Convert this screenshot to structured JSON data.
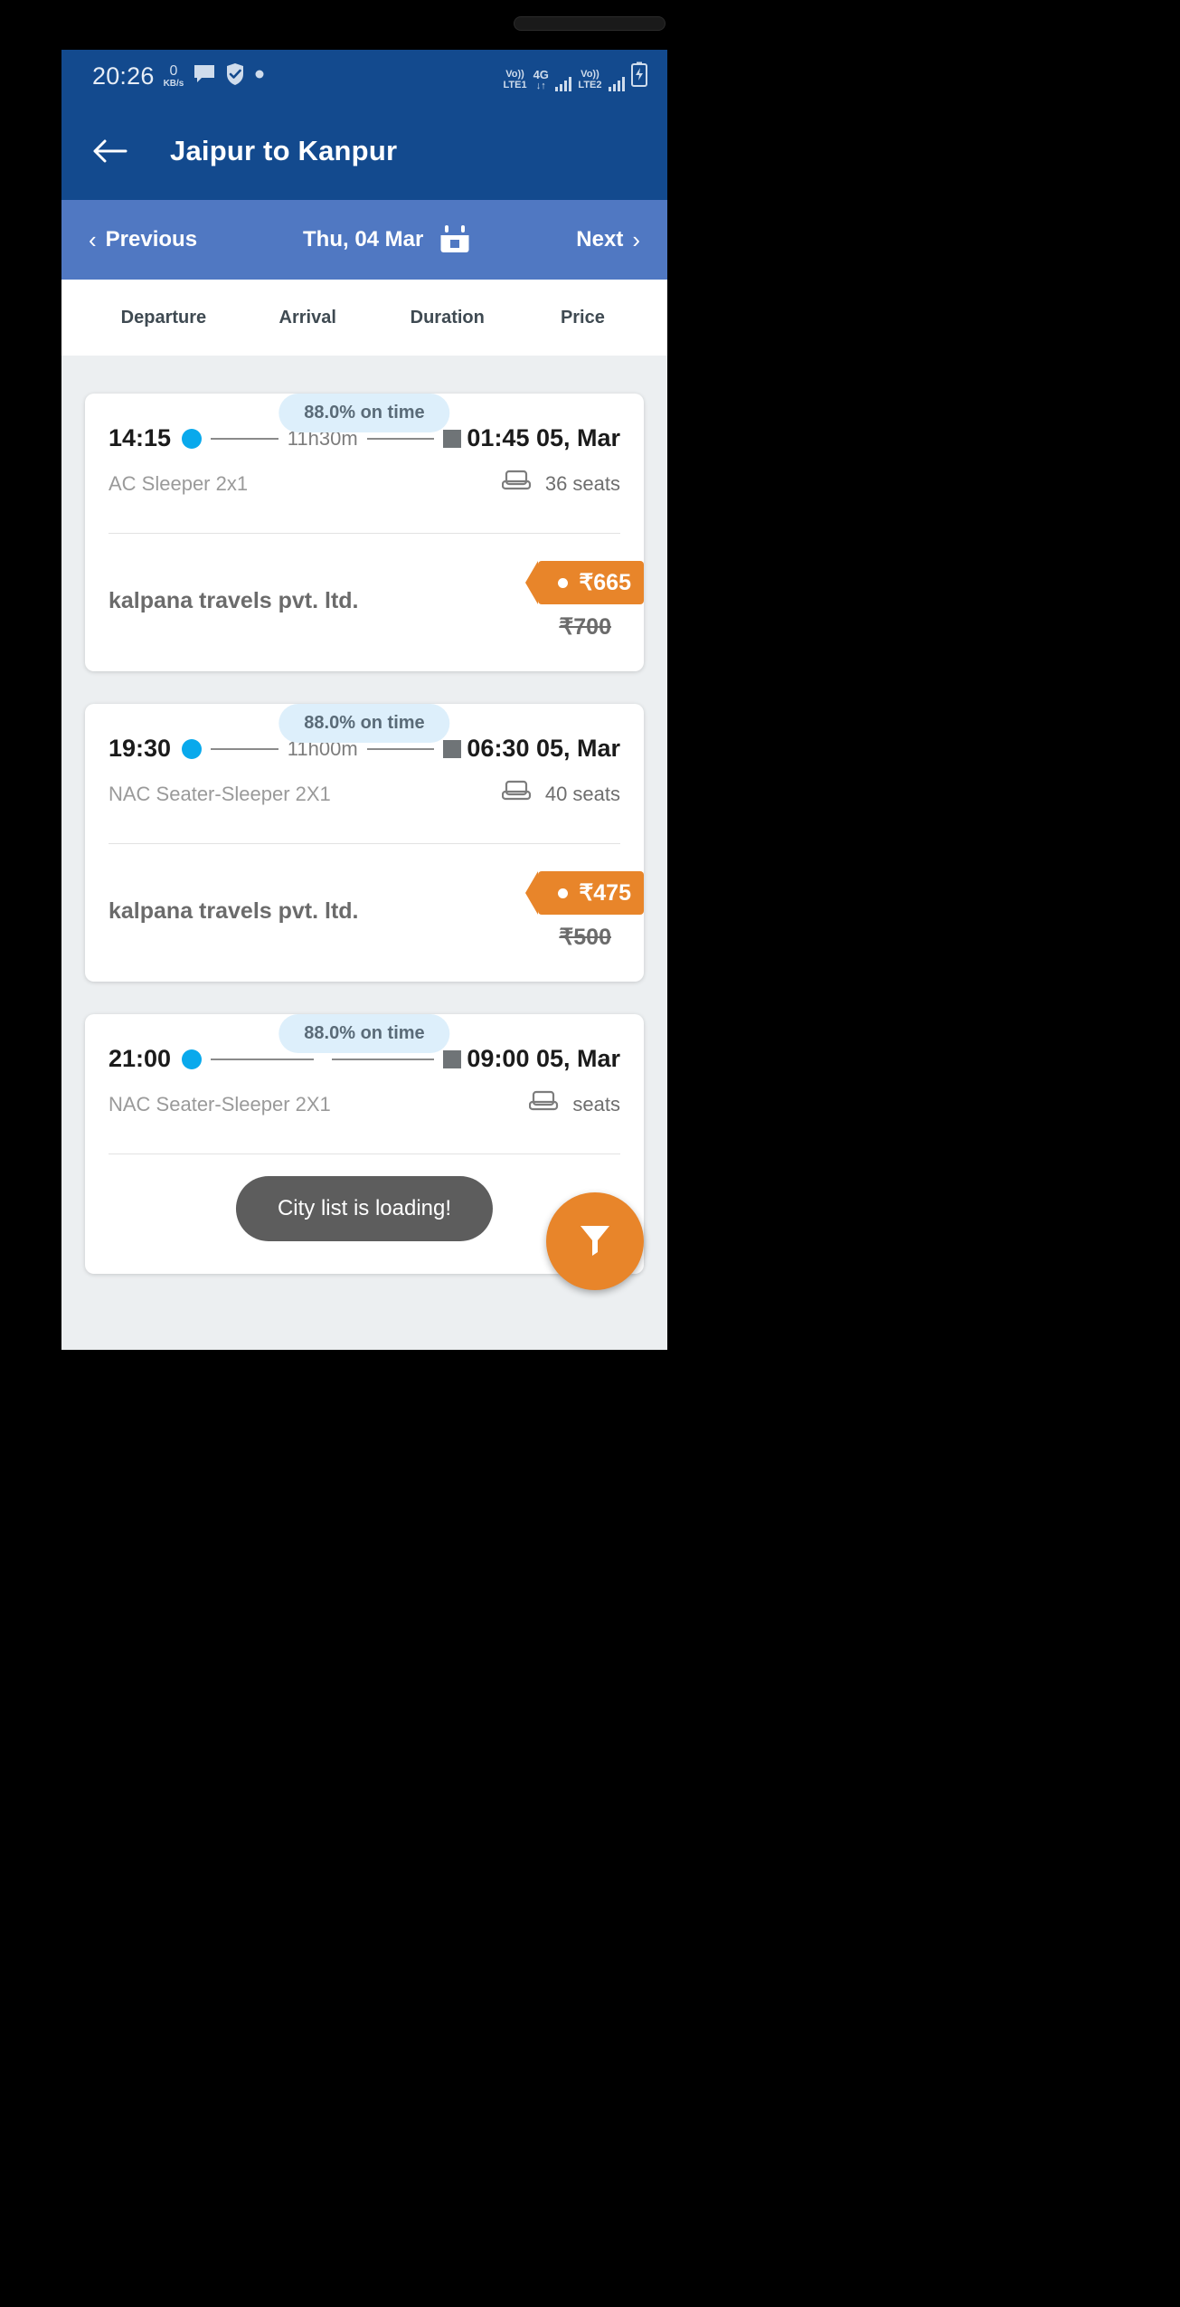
{
  "status_bar": {
    "clock": "20:26",
    "net_speed_value": "0",
    "net_speed_unit": "KB/s",
    "message_icon": "message-icon",
    "shield_icon": "shield-check-icon",
    "dot_icon": "dot-icon",
    "sim1_top": "Vo))",
    "sim1_bottom": "LTE1",
    "network_type": "4G",
    "data_arrows": "↓↑",
    "sim2_top": "Vo))",
    "sim2_bottom": "LTE2",
    "battery_icon": "battery-charging-icon"
  },
  "app_bar": {
    "back_icon": "back-arrow-icon",
    "title": "Jaipur to Kanpur"
  },
  "date_nav": {
    "previous_label": "Previous",
    "previous_icon": "chevron-left-icon",
    "date": "Thu, 04 Mar",
    "calendar_icon": "calendar-icon",
    "next_label": "Next",
    "next_icon": "chevron-right-icon"
  },
  "columns": [
    {
      "label": "Departure"
    },
    {
      "label": "Arrival"
    },
    {
      "label": "Duration"
    },
    {
      "label": "Price"
    }
  ],
  "buses": [
    {
      "on_time": "88.0% on time",
      "departure": "14:15",
      "duration": "11h30m",
      "arrival": "01:45 05, Mar",
      "bus_type": "AC Sleeper 2x1",
      "seats": "36 seats",
      "seat_icon": "seat-icon",
      "operator": "kalpana travels pvt. ltd.",
      "price": "₹665",
      "price_old": "₹700"
    },
    {
      "on_time": "88.0% on time",
      "departure": "19:30",
      "duration": "11h00m",
      "arrival": "06:30 05, Mar",
      "bus_type": "NAC Seater-Sleeper 2X1",
      "seats": "40 seats",
      "seat_icon": "seat-icon",
      "operator": "kalpana travels pvt. ltd.",
      "price": "₹475",
      "price_old": "₹500"
    },
    {
      "on_time": "88.0% on time",
      "departure": "21:00",
      "duration": "",
      "arrival": "09:00 05, Mar",
      "bus_type": "NAC Seater-Sleeper 2X1",
      "seats": "seats",
      "seat_icon": "seat-icon",
      "operator": "",
      "price": "",
      "price_old": ""
    }
  ],
  "toast": {
    "message": "City list is loading!"
  },
  "fab": {
    "icon": "filter-funnel-icon"
  },
  "android_nav": {
    "recents_icon": "recents-icon",
    "home_icon": "home-icon",
    "back_icon": "back-icon"
  },
  "colors": {
    "app_bar": "#134a8e",
    "date_nav": "#5078c2",
    "accent_orange": "#e8852a",
    "on_time_pill_bg": "#ddeffb",
    "dot_blue": "#09a9ec",
    "page_bg": "#eceff1"
  }
}
